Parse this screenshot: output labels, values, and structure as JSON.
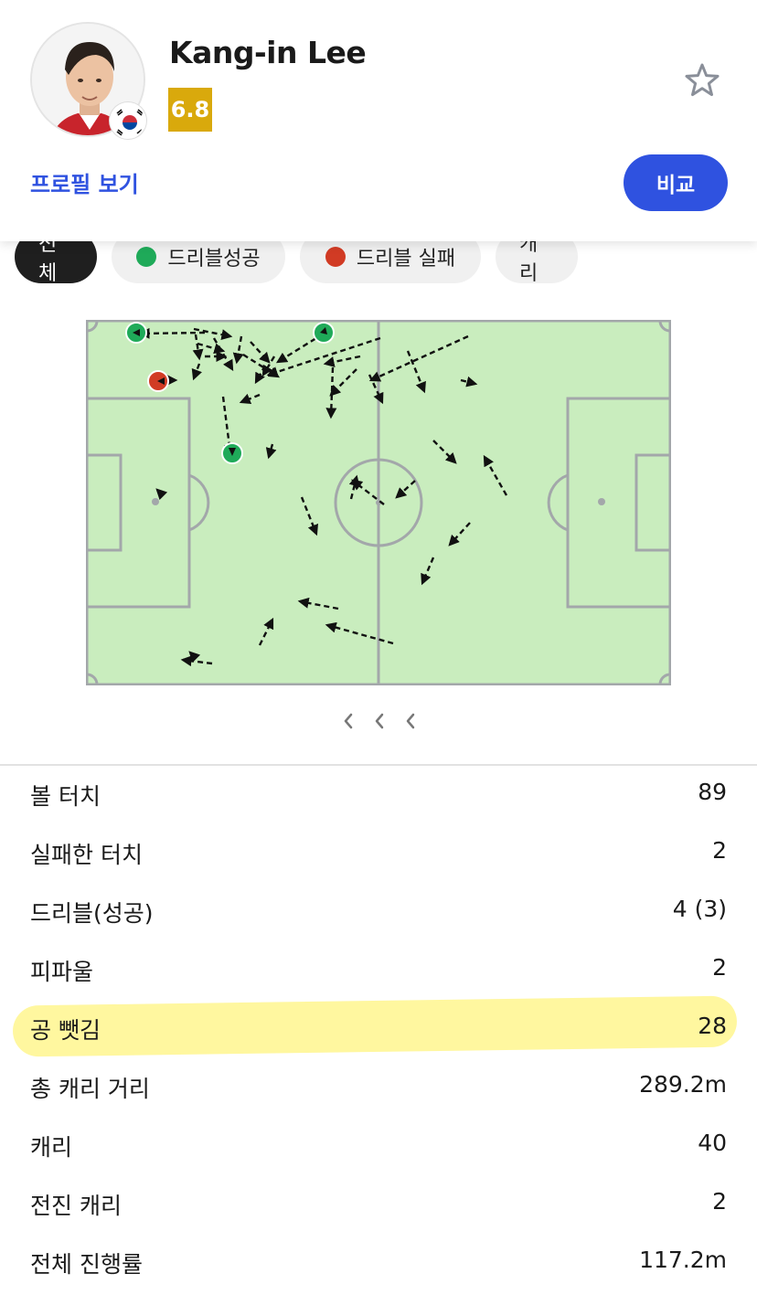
{
  "player": {
    "name": "Kang-in Lee",
    "rating": "6.8",
    "nationality_flag": "south-korea-flag-icon",
    "profile_link": "프로필 보기",
    "compare_button": "비교"
  },
  "colors": {
    "accent": "#2f52e0",
    "rating_badge": "#d9a90c",
    "dribble_success": "#1faa59",
    "dribble_fail": "#d13b24",
    "pitch": "#c9edbe",
    "highlight": "#fff050"
  },
  "filters": [
    {
      "label": "전체",
      "active": true
    },
    {
      "label": "드리블성공",
      "dot": "green"
    },
    {
      "label": "드리블 실패",
      "dot": "red"
    },
    {
      "label": "캐리"
    }
  ],
  "stats": [
    {
      "label": "볼 터치",
      "value": "89"
    },
    {
      "label": "실패한 터치",
      "value": "2"
    },
    {
      "label": "드리블(성공)",
      "value": "4 (3)"
    },
    {
      "label": "피파울",
      "value": "2"
    },
    {
      "label": "공 뺏김",
      "value": "28"
    },
    {
      "label": "총 캐리 거리",
      "value": "289.2m"
    },
    {
      "label": "캐리",
      "value": "40"
    },
    {
      "label": "전진 캐리",
      "value": "2"
    },
    {
      "label": "전체 진행률",
      "value": "117.2m"
    }
  ]
}
